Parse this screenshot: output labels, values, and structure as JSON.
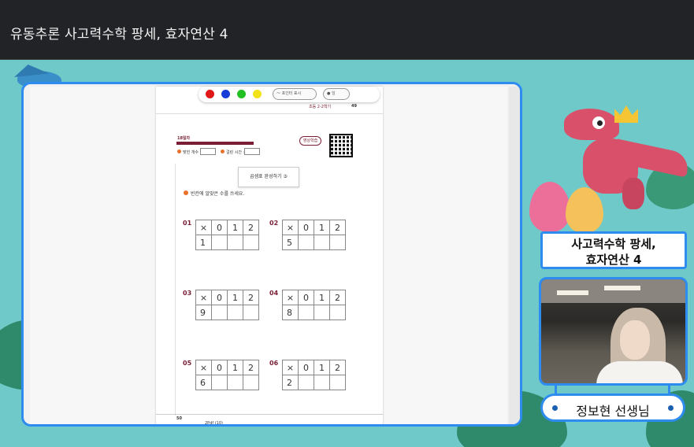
{
  "window": {
    "title": "유동추론 사고력수학 팡세, 효자연산 4"
  },
  "toolbar": {
    "colors": [
      "#e01818",
      "#1a3cd6",
      "#22c022",
      "#f2e21a"
    ],
    "pointer_label": "포인터 표시",
    "other_label": "잉"
  },
  "page_header": {
    "book_name": "초등 2-2학기",
    "page_number": "49"
  },
  "lesson": {
    "day_label": "18일차",
    "correct_label": "맞힌 개수 :",
    "time_label": "걸린 시간 :",
    "video_label": "영상학습",
    "section_title": "곱셈표 완성하기 ③",
    "instruction": "빈칸에 알맞은 수를 쓰세요."
  },
  "problems": [
    {
      "num": "01",
      "header": [
        "×",
        "0",
        "1",
        "2"
      ],
      "first": "1"
    },
    {
      "num": "02",
      "header": [
        "×",
        "0",
        "1",
        "2"
      ],
      "first": "5"
    },
    {
      "num": "03",
      "header": [
        "×",
        "0",
        "1",
        "2"
      ],
      "first": "9"
    },
    {
      "num": "04",
      "header": [
        "×",
        "0",
        "1",
        "2"
      ],
      "first": "8"
    },
    {
      "num": "05",
      "header": [
        "×",
        "0",
        "1",
        "2"
      ],
      "first": "6"
    },
    {
      "num": "06",
      "header": [
        "×",
        "0",
        "1",
        "2"
      ],
      "first": "2"
    }
  ],
  "page_footer": {
    "page_number": "50",
    "bottom_label": "2Pdf (10)"
  },
  "side_panel": {
    "course_title_line1": "사고력수학 팡세,",
    "course_title_line2": "효자연산 4",
    "teacher_name": "정보현 선생님"
  }
}
